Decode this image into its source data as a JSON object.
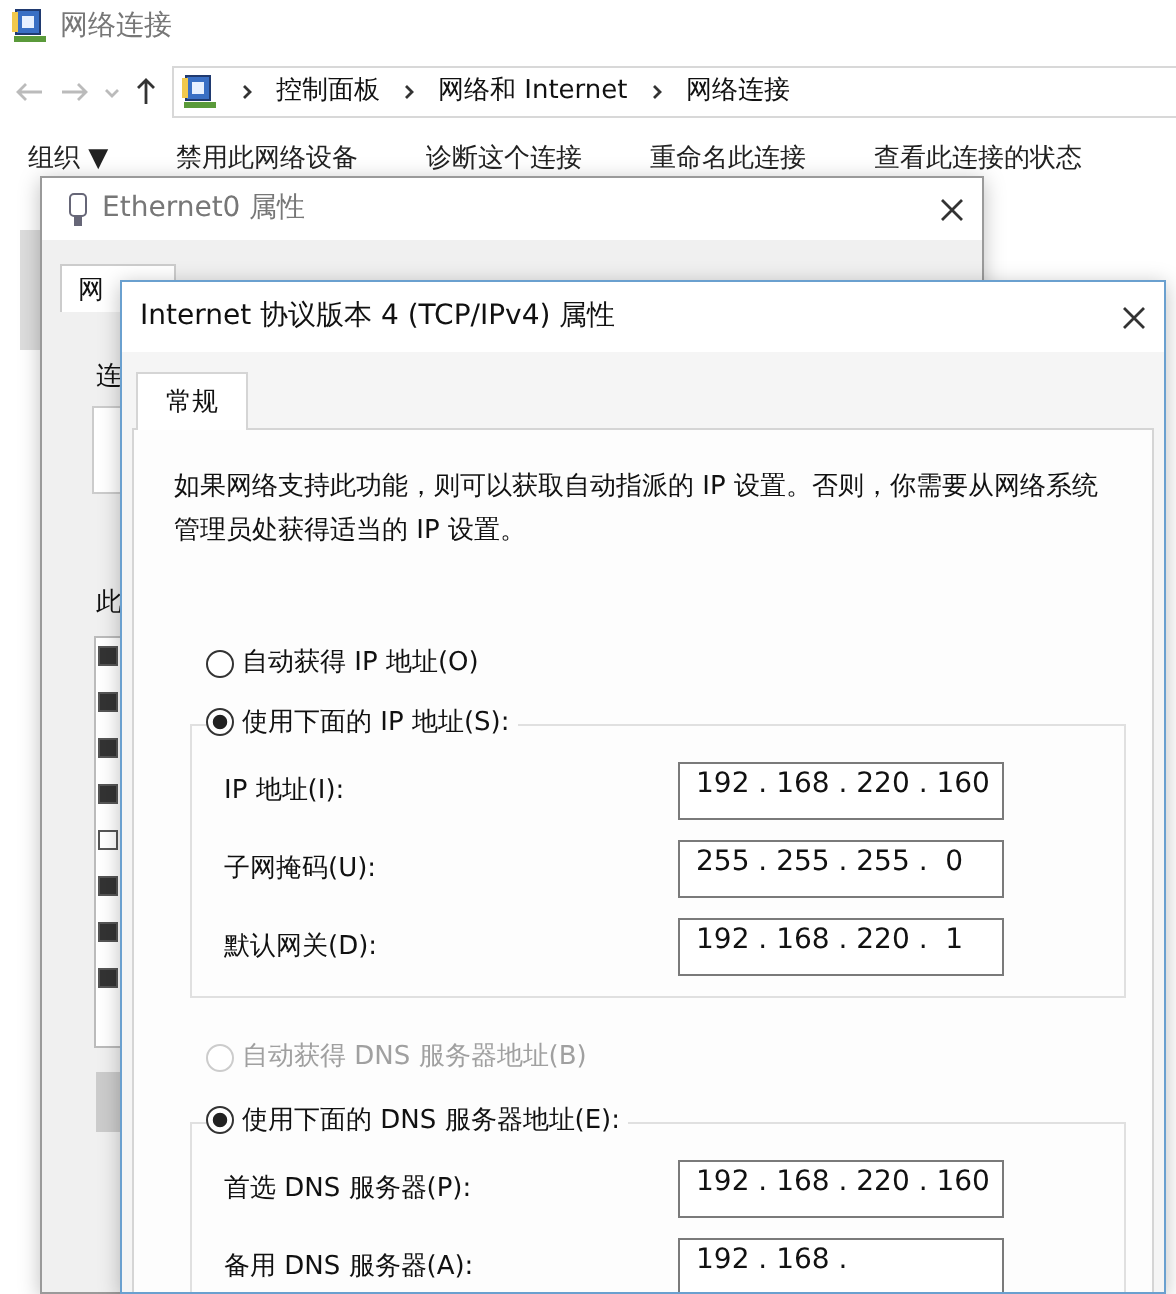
{
  "explorer": {
    "title": "网络连接",
    "breadcrumbs": [
      "控制面板",
      "网络和 Internet",
      "网络连接"
    ],
    "toolbar": [
      "组织 ▼",
      "禁用此网络设备",
      "诊断这个连接",
      "重命名此连接",
      "查看此连接的状态"
    ]
  },
  "ethernet_dialog": {
    "title": "Ethernet0 属性",
    "tab": "网",
    "labels": [
      "连",
      "此"
    ],
    "components": [
      {
        "checked": true
      },
      {
        "checked": true
      },
      {
        "checked": true
      },
      {
        "checked": true
      },
      {
        "checked": false
      },
      {
        "checked": true
      },
      {
        "checked": true
      },
      {
        "checked": true
      }
    ]
  },
  "ipv4_dialog": {
    "title": "Internet 协议版本 4 (TCP/IPv4) 属性",
    "tabs": [
      {
        "label": "常规",
        "selected": true
      }
    ],
    "description": "如果网络支持此功能，则可以获取自动指派的 IP 设置。否则，你需要从网络系统管理员处获得适当的 IP 设置。",
    "ip_options": [
      {
        "label": "自动获得 IP 地址(O)",
        "selected": false,
        "disabled": false
      },
      {
        "label": "使用下面的 IP 地址(S):",
        "selected": true,
        "disabled": false
      }
    ],
    "ip_fields": [
      {
        "label": "IP 地址(I):",
        "value": "192 . 168 . 220 . 160"
      },
      {
        "label": "子网掩码(U):",
        "value": "255 . 255 . 255 .  0"
      },
      {
        "label": "默认网关(D):",
        "value": "192 . 168 . 220 .  1"
      }
    ],
    "dns_options": [
      {
        "label": "自动获得 DNS 服务器地址(B)",
        "selected": false,
        "disabled": true
      },
      {
        "label": "使用下面的 DNS 服务器地址(E):",
        "selected": true,
        "disabled": false
      }
    ],
    "dns_fields": [
      {
        "label": "首选 DNS 服务器(P):",
        "value": "192 . 168 . 220 . 160"
      },
      {
        "label": "备用 DNS 服务器(A):",
        "value": "192 . 168 ."
      }
    ]
  }
}
